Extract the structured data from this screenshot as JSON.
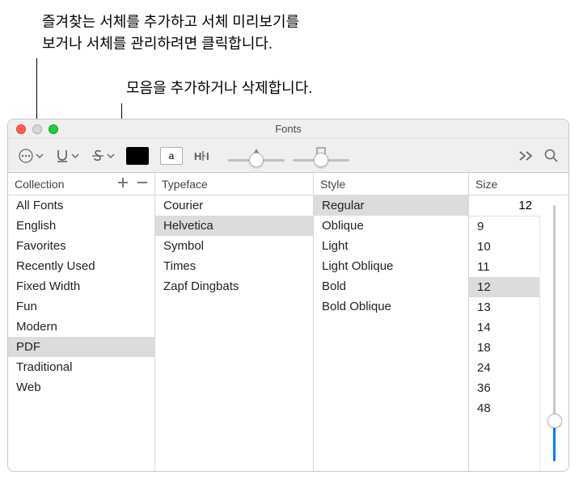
{
  "annotations": {
    "line1": "즐겨찾는 서체를 추가하고 서체 미리보기를",
    "line2": "보거나 서체를 관리하려면 클릭합니다.",
    "line3": "모음을 추가하거나 삭제합니다."
  },
  "window": {
    "title": "Fonts"
  },
  "toolbar": {
    "textbg_letter": "a",
    "char_spacing_label": "H⊦I"
  },
  "columns": {
    "collection": {
      "header": "Collection",
      "items": [
        "All Fonts",
        "English",
        "Favorites",
        "Recently Used",
        "Fixed Width",
        "Fun",
        "Modern",
        "PDF",
        "Traditional",
        "Web"
      ],
      "selected": "PDF"
    },
    "typeface": {
      "header": "Typeface",
      "items": [
        "Courier",
        "Helvetica",
        "Symbol",
        "Times",
        "Zapf Dingbats"
      ],
      "selected": "Helvetica"
    },
    "style": {
      "header": "Style",
      "items": [
        "Regular",
        "Oblique",
        "Light",
        "Light Oblique",
        "Bold",
        "Bold Oblique"
      ],
      "selected": "Regular"
    },
    "size": {
      "header": "Size",
      "current": "12",
      "items": [
        "9",
        "10",
        "11",
        "12",
        "13",
        "14",
        "18",
        "24",
        "36",
        "48"
      ],
      "selected": "12"
    }
  }
}
